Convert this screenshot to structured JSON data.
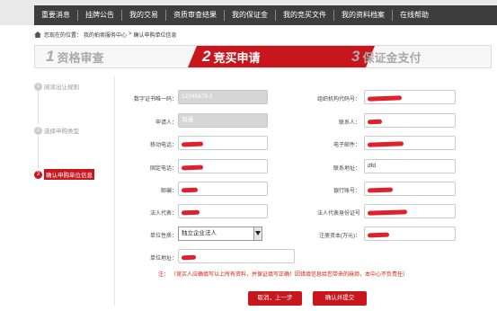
{
  "nav": {
    "items": [
      "重要消息",
      "挂牌公告",
      "我的交易",
      "资质审查结果",
      "我的保证金",
      "我的竞买文件",
      "我的资料档案",
      "在线帮助"
    ]
  },
  "breadcrumb": {
    "prefix": "您现在的位置：",
    "path": "我的拍卖服务中心",
    "sep": ">",
    "current": "确认申购单位信息"
  },
  "steps": [
    {
      "num": "1",
      "label": "资格审查"
    },
    {
      "num": "2",
      "label": "竞买申请"
    },
    {
      "num": "3",
      "label": "保证金支付"
    }
  ],
  "side_steps": [
    {
      "num": "1",
      "label": "阅读出让规则"
    },
    {
      "num": "2",
      "label": "选择申购类型"
    },
    {
      "num": "3",
      "label": "确认申购单位信息"
    }
  ],
  "form": {
    "cert_no_label": "数字证书唯一码：",
    "cert_no_value": "12345678-1",
    "org_code_label": "组织机构代码号：",
    "applicant_label": "申请人：",
    "applicant_value": "周通",
    "contact_label": "联系人：",
    "mobile_label": "移动电话：",
    "email_label": "电子邮件：",
    "landline_label": "固定电话：",
    "address_label": "联系地址：",
    "address_value": "dfd",
    "postcode_label": "邮编：",
    "bank_label": "银行账号：",
    "legal_rep_label": "法人代表：",
    "legal_id_label": "法人代表身份证号",
    "unit_type_label": "单位性质：",
    "unit_type_value": "独立企业法人",
    "capital_label": "注册资本(万元)：",
    "unit_addr_label": "单位地址："
  },
  "note": {
    "prefix": "注：",
    "text": "（竞买人应确填写以上所有资料，并保证填写正确！因错填信息给您带来的麻烦，本中心不负责任）"
  },
  "buttons": {
    "back": "取消，上一步",
    "submit": "确认并提交"
  },
  "colors": {
    "accent": "#c8161d",
    "nav_bg": "#3d3d3d"
  }
}
